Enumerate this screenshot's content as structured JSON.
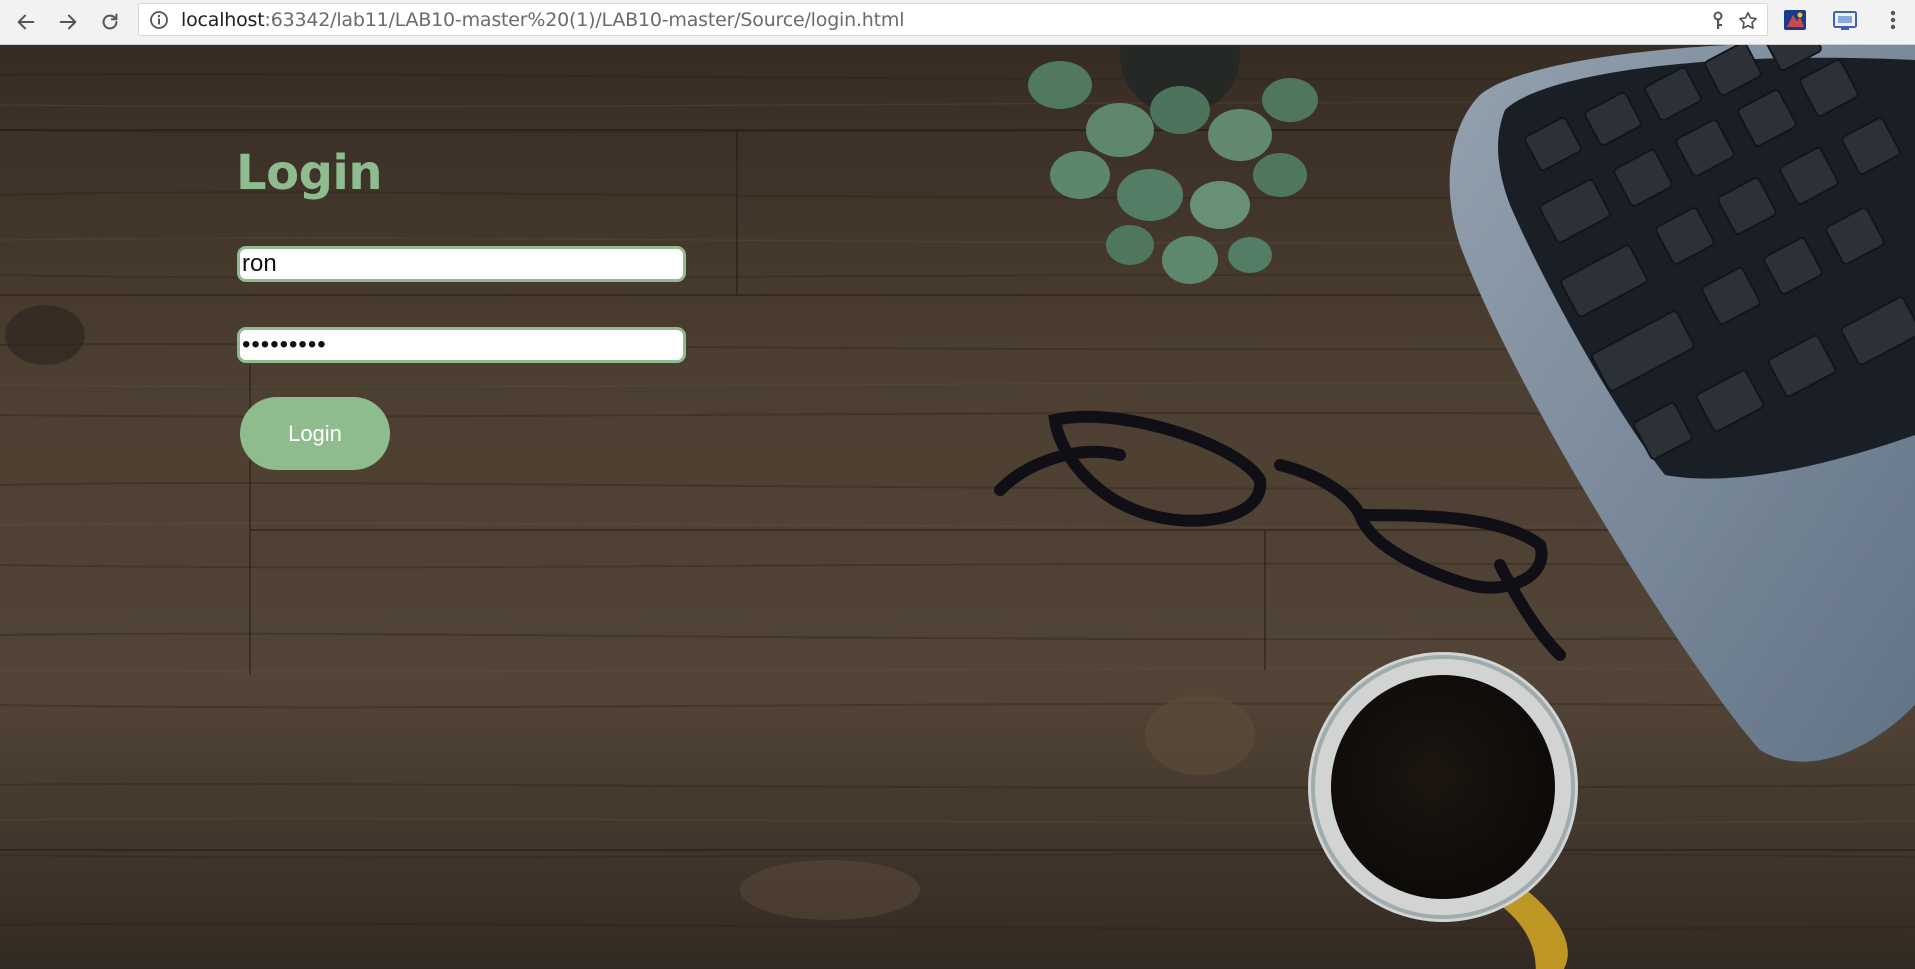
{
  "browser": {
    "url_host": "localhost",
    "url_rest": ":63342/lab11/LAB10-master%20(1)/LAB10-master/Source/login.html",
    "icons": [
      "back-arrow-icon",
      "forward-arrow-icon",
      "reload-icon",
      "info-icon",
      "key-icon",
      "star-icon",
      "extension-icon",
      "cast-icon",
      "menu-icon"
    ]
  },
  "login": {
    "title": "Login",
    "username_value": "ron",
    "password_value": "•••••••••",
    "button_label": "Login"
  },
  "colors": {
    "accent": "#8fbc8f",
    "wood": "#5a4a3a"
  }
}
